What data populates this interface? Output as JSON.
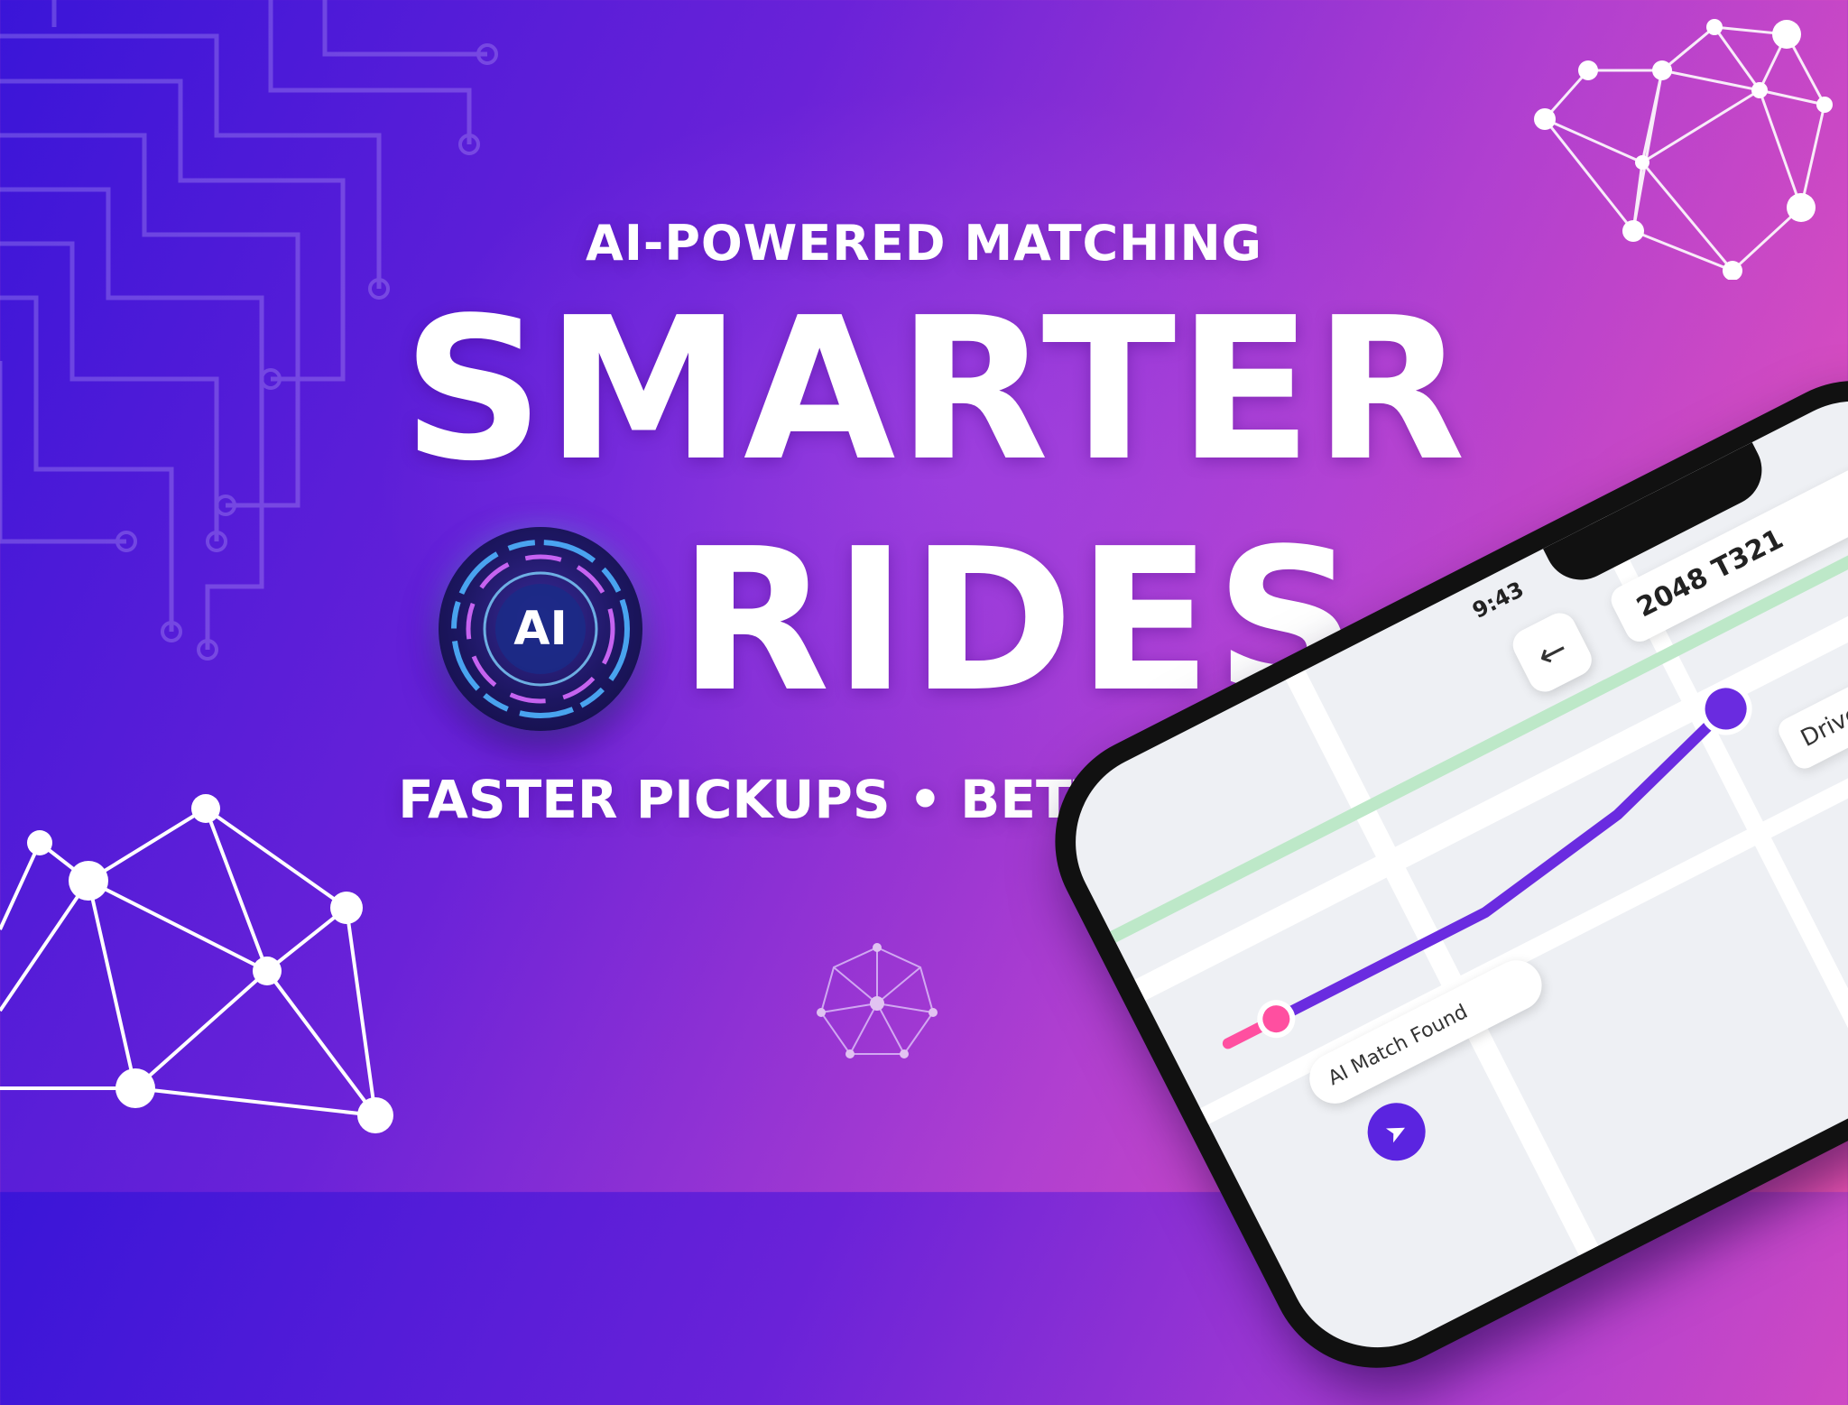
{
  "hero": {
    "eyebrow": "AI-POWERED MATCHING",
    "title_line1": "SMARTER",
    "title_line2": "RIDES",
    "tagline": "FASTER PICKUPS • BETTER ROUTES"
  },
  "badge": {
    "label": "AI"
  },
  "phone": {
    "status_time": "9:43",
    "back_icon": "arrow-left-icon",
    "route_code": "2048 T321",
    "driver_label": "Driver Arriving",
    "match_label": "AI Match Found",
    "nav_icon": "navigation-arrow-icon"
  },
  "colors": {
    "gradient_start": "#3a15d8",
    "gradient_mid": "#b03fd0",
    "gradient_end": "#f256b4",
    "route_line": "#6a2be0",
    "accent_pin": "#ff4fa0"
  }
}
